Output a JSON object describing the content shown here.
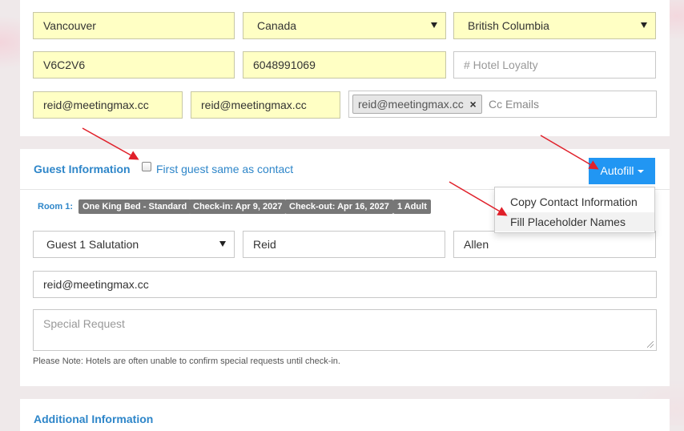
{
  "address": {
    "city": "Vancouver",
    "country": "Canada",
    "province": "British Columbia",
    "postal_code": "V6C2V6",
    "phone": "6048991069",
    "loyalty_placeholder": "# Hotel Loyalty",
    "email": "reid@meetingmax.cc",
    "confirm_email": "reid@meetingmax.cc",
    "cc_tag": "reid@meetingmax.cc",
    "cc_tag_remove": "×",
    "cc_placeholder": "Cc Emails"
  },
  "guest_section": {
    "title": "Guest Information",
    "same_as_contact_label": "First guest same as contact",
    "autofill_label": "Autofill",
    "autofill_menu": [
      "Copy Contact Information",
      "Fill Placeholder Names"
    ],
    "room_label": "Room 1:",
    "badges": [
      "One King Bed - Standard",
      "Check-in: Apr 9, 2027",
      "Check-out: Apr 16, 2027",
      "1 Adult"
    ],
    "salutation": "Guest 1 Salutation",
    "first_name": "Reid",
    "last_name": "Allen",
    "email": "reid@meetingmax.cc",
    "special_request_placeholder": "Special Request",
    "note": "Please Note: Hotels are often unable to confirm special requests until check-in."
  },
  "additional_section": {
    "title": "Additional Information"
  },
  "colors": {
    "accent": "#2e86c9",
    "autofill_button": "#2196f3",
    "autofilled_field": "#ffffc4",
    "annotation_arrow": "#e0202a"
  }
}
